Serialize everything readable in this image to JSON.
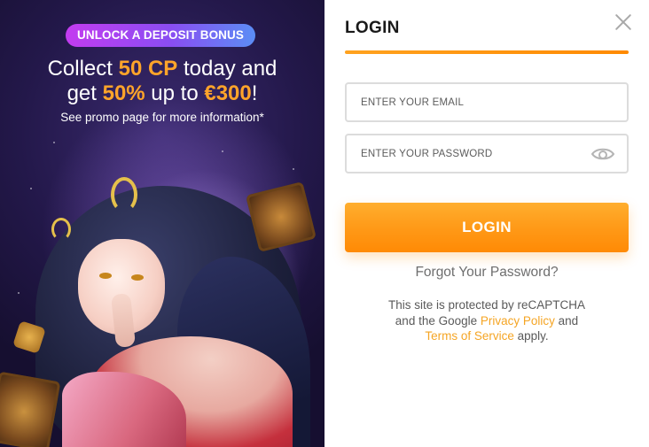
{
  "promo": {
    "badge": "UNLOCK A DEPOSIT BONUS",
    "line1_pre": "Collect ",
    "line1_highlight": "50 CP",
    "line1_post": " today and",
    "line2_pre": "get ",
    "line2_highlight1": "50%",
    "line2_mid": " up to ",
    "line2_highlight2": "€300",
    "line2_post": "!",
    "note": "See promo page for more information*"
  },
  "login": {
    "title": "LOGIN",
    "email_placeholder": "ENTER YOUR EMAIL",
    "password_placeholder": "ENTER YOUR PASSWORD",
    "submit_label": "LOGIN",
    "forgot_label": "Forgot Your Password?",
    "legal_line1": "This site is protected by reCAPTCHA",
    "legal_line2_pre": "and the Google ",
    "privacy_link": "Privacy Policy",
    "legal_line2_post": " and",
    "terms_link": "Terms of Service",
    "legal_line3_post": " apply."
  },
  "colors": {
    "accent": "#ff9a18",
    "highlight": "#ffa42a",
    "badge_start": "#c33cf0",
    "badge_end": "#5b8df5",
    "link": "#f5a524"
  },
  "icons": {
    "close": "close-icon",
    "password_toggle": "eye-icon"
  }
}
